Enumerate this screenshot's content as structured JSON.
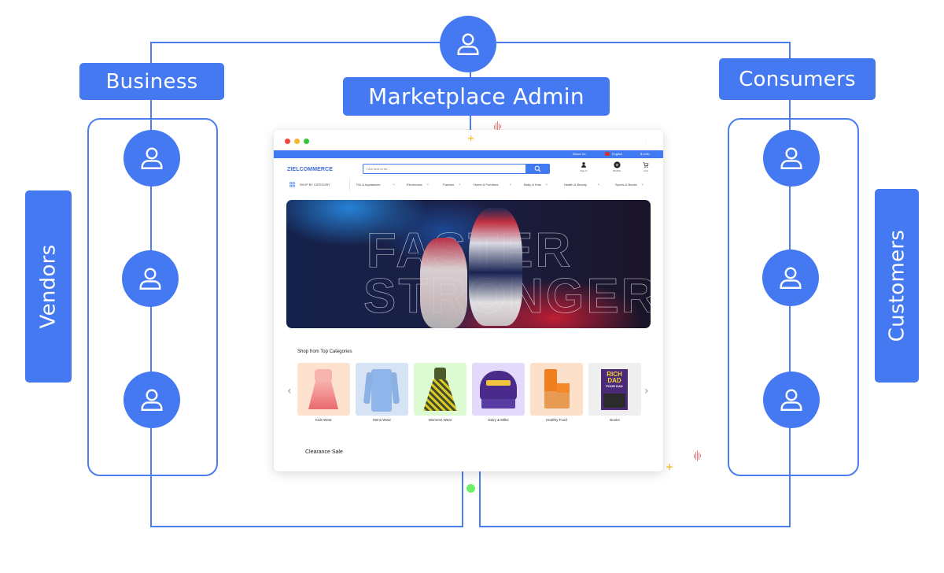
{
  "diagram": {
    "admin_label": "Marketplace Admin",
    "business_label": "Business",
    "consumers_label": "Consumers",
    "vendors_label": "Vendors",
    "customers_label": "Customers",
    "accent_color": "#4479f2"
  },
  "storefront": {
    "window_dots": [
      "#f5453d",
      "#f8b82e",
      "#36c43b"
    ],
    "topbar": {
      "about": "About Us",
      "language": "English",
      "currency": "$ USD"
    },
    "logo": "ZIELCOMMERCE",
    "search_placeholder": "I Am look in for...",
    "header_icons": [
      {
        "icon": "user-icon",
        "label": "Sign In"
      },
      {
        "icon": "wishlist-icon",
        "label": "Wishlist"
      },
      {
        "icon": "cart-icon",
        "label": "Cart"
      }
    ],
    "shop_by_category": "SHOP BY CATEGORY",
    "nav": [
      "TVs & Appliances",
      "Electronics",
      "Fashion",
      "Home & Furniture",
      "Baby & Kids",
      "Health & Beauty",
      "Sports & Books"
    ],
    "hero": {
      "line1": "FASTER",
      "line2": "STRONGER"
    },
    "top_categories_title": "Shop from Top Categories",
    "categories": [
      {
        "label": "Kids Wear",
        "bg": "#fde3cf"
      },
      {
        "label": "Mens Wear",
        "bg": "#d6e3f5"
      },
      {
        "label": "Womens Wear",
        "bg": "#dcfbd3"
      },
      {
        "label": "Dairy & Milks",
        "bg": "#e3dafb"
      },
      {
        "label": "Healthy Food",
        "bg": "#fde0c9"
      },
      {
        "label": "Books",
        "bg": "#efefef"
      }
    ],
    "book_title": [
      "RICH",
      "DAD",
      "POOR DAD"
    ],
    "clearance_title": "Clearance Sale"
  }
}
